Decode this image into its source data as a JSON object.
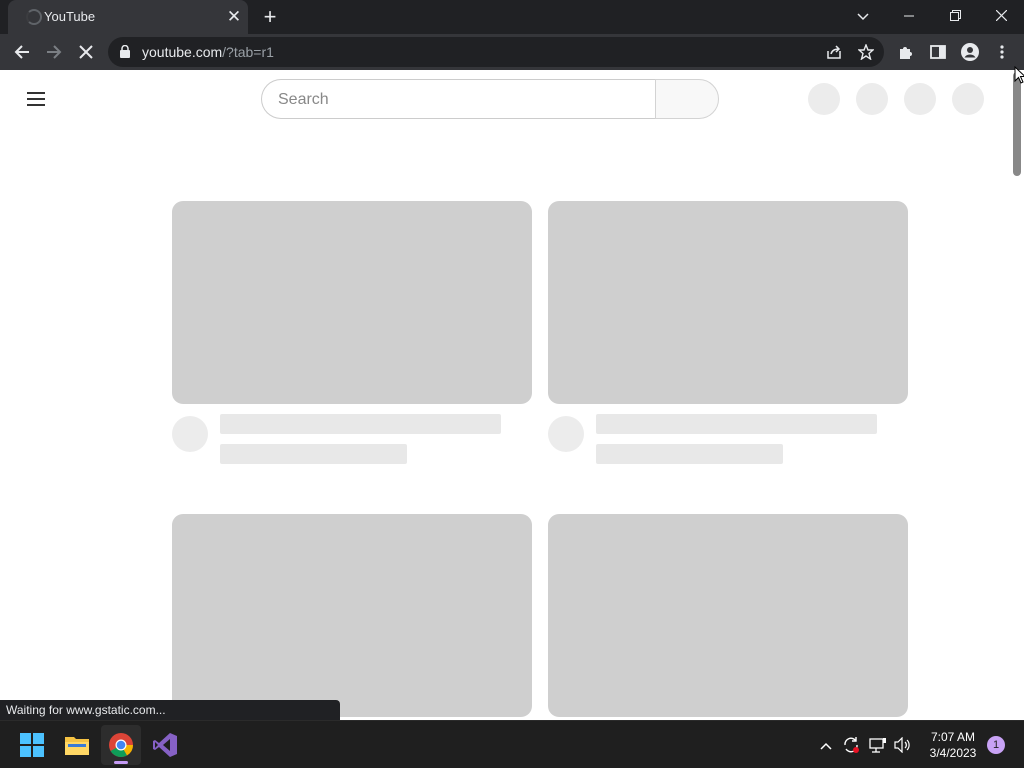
{
  "browser": {
    "tab": {
      "title": "YouTube",
      "close_glyph": "✕"
    },
    "new_tab_glyph": "+",
    "window_controls": {
      "tab_search": "⌄",
      "minimize": "—",
      "restore": "❐",
      "close": "✕"
    },
    "address_bar": {
      "domain": "youtube.com",
      "path": "/?tab=r1"
    },
    "status_text": "Waiting for www.gstatic.com..."
  },
  "youtube": {
    "search": {
      "placeholder": "Search",
      "value": ""
    }
  },
  "taskbar": {
    "apps": [
      "start-icon",
      "file-explorer-icon",
      "chrome-icon",
      "visual-studio-icon"
    ],
    "clock": {
      "time": "7:07 AM",
      "date": "3/4/2023"
    },
    "notification_count": "1"
  },
  "colors": {
    "chrome_dark": "#202124",
    "chrome_toolbar": "#35363a",
    "skeleton_thumb": "#cfcfcf",
    "skeleton_line": "#e8e8e8",
    "taskbar": "#1f1f1f",
    "accent": "#c59bf5"
  }
}
